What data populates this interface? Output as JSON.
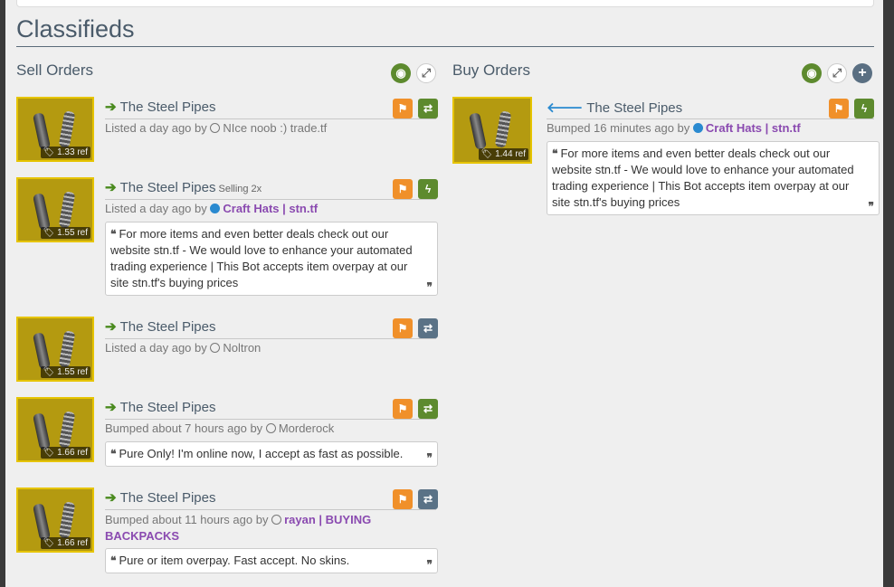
{
  "page": {
    "title": "Classifieds"
  },
  "sell": {
    "title": "Sell Orders",
    "listings": [
      {
        "item": "The Steel Pipes",
        "price": "1.33 ref",
        "selling": "",
        "meta_prefix": "Listed a day ago by",
        "user": "NIce noob :) trade.tf",
        "user_strong": false,
        "message": ""
      },
      {
        "item": "The Steel Pipes",
        "price": "1.55 ref",
        "selling": "Selling 2x",
        "meta_prefix": "Listed a day ago by",
        "user": "Craft Hats | stn.tf",
        "user_strong": true,
        "message": "For more items and even better deals check out our website stn.tf - We would love to enhance your automated trading experience | This Bot accepts item overpay at our site stn.tf's buying prices"
      },
      {
        "item": "The Steel Pipes",
        "price": "1.55 ref",
        "selling": "",
        "meta_prefix": "Listed a day ago by",
        "user": "Noltron",
        "user_strong": false,
        "message": ""
      },
      {
        "item": "The Steel Pipes",
        "price": "1.66 ref",
        "selling": "",
        "meta_prefix": "Bumped about 7 hours ago by",
        "user": "Morderock",
        "user_strong": false,
        "message": "Pure Only! I'm online now, I accept as fast as possible."
      },
      {
        "item": "The Steel Pipes",
        "price": "1.66 ref",
        "selling": "",
        "meta_prefix": "Bumped about 11 hours ago by",
        "user": "rayan | BUYING",
        "user_line2": "BACKPACKS",
        "user_strong": true,
        "message": "Pure or item overpay. Fast accept. No skins."
      }
    ]
  },
  "buy": {
    "title": "Buy Orders",
    "listings": [
      {
        "item": "The Steel Pipes",
        "price": "1.44 ref",
        "meta_prefix": "Bumped 16 minutes ago by",
        "user": "Craft Hats | stn.tf",
        "user_strong": true,
        "message": "For more items and even better deals check out our website stn.tf - We would love to enhance your automated trading experience | This Bot accepts item overpay at our site stn.tf's buying prices"
      }
    ]
  },
  "icons": {
    "eye": "eye-icon",
    "expand": "expand-icon",
    "plus": "plus-icon",
    "flag": "flag-icon",
    "trade": "trade-icon",
    "lightning": "lightning-icon",
    "arrow_right": "arrow-right-icon",
    "arrow_left": "arrow-left-icon",
    "tag": "tag-icon",
    "quote_open": "quote-open-icon",
    "quote_close": "quote-close-icon"
  },
  "colors": {
    "orange": "#f0902a",
    "green": "#5d8a2e",
    "slate": "#5a7286",
    "blue": "#2a8ad0",
    "purple": "#8a4ab0",
    "item_bg": "#b49a10"
  }
}
